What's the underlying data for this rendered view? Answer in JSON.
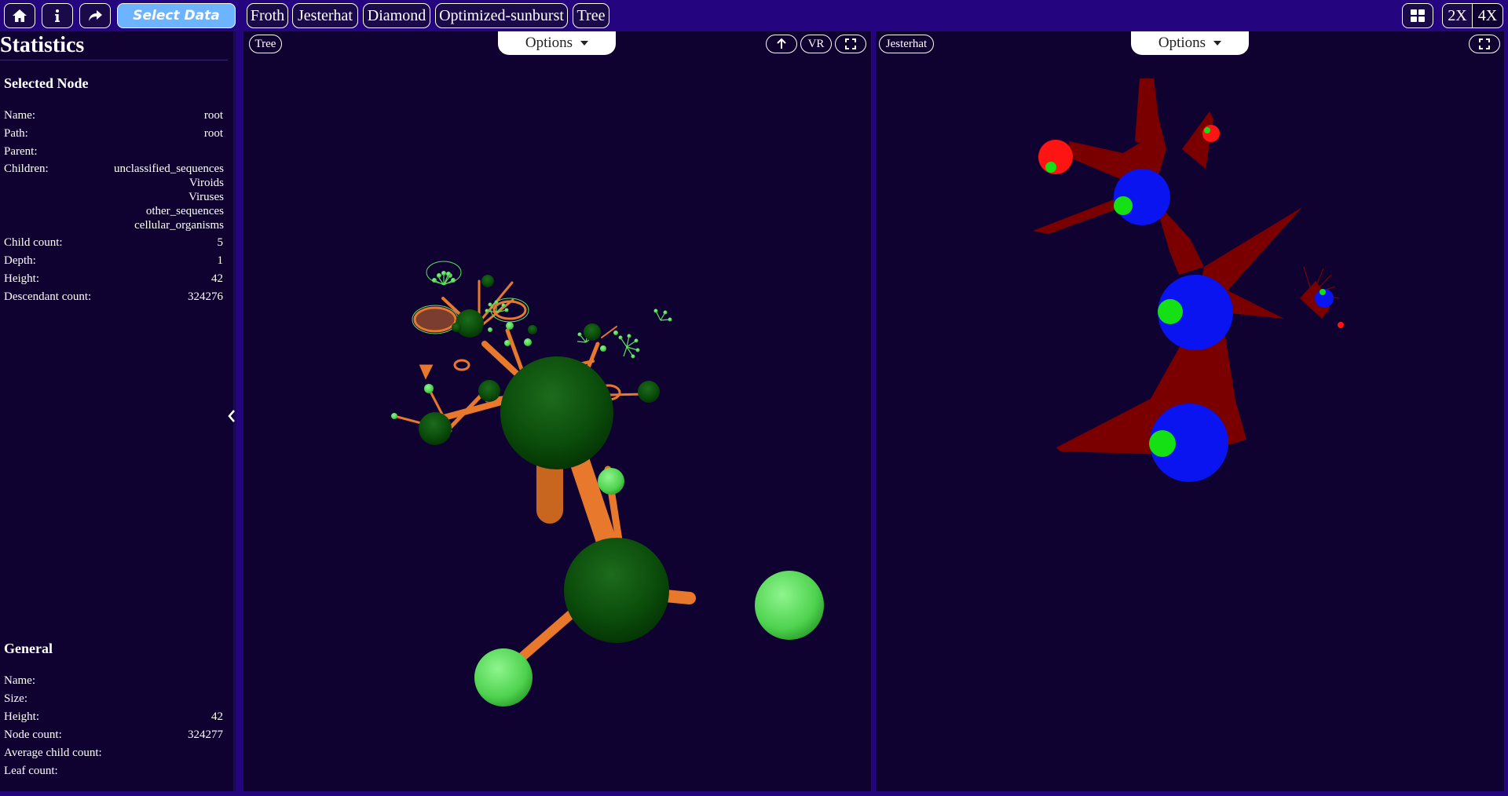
{
  "toolbar": {
    "home_icon": "home-icon",
    "info_icon": "info-icon",
    "share_icon": "share-icon",
    "select_data_label": "Select Data",
    "views": [
      "Froth",
      "Jesterhat",
      "Diamond",
      "Optimized-sunburst",
      "Tree"
    ],
    "grid_icon": "grid-layout-icon",
    "zoom_2x": "2X",
    "zoom_4x": "4X"
  },
  "sidebar": {
    "title": "Statistics",
    "selected_node": {
      "heading": "Selected Node",
      "name_label": "Name:",
      "name_value": "root",
      "path_label": "Path:",
      "path_value": "root",
      "parent_label": "Parent:",
      "parent_value": "",
      "children_label": "Children:",
      "children": [
        "unclassified_sequences",
        "Viroids",
        "Viruses",
        "other_sequences",
        "cellular_organisms"
      ],
      "child_count_label": "Child count:",
      "child_count_value": "5",
      "depth_label": "Depth:",
      "depth_value": "1",
      "height_label": "Height:",
      "height_value": "42",
      "descendant_label": "Descendant count:",
      "descendant_value": "324276"
    },
    "general": {
      "heading": "General",
      "name_label": "Name:",
      "name_value": "",
      "size_label": "Size:",
      "size_value": "",
      "height_label": "Height:",
      "height_value": "42",
      "node_count_label": "Node count:",
      "node_count_value": "324277",
      "avg_child_label": "Average child count:",
      "avg_child_value": "",
      "leaf_count_label": "Leaf count:",
      "leaf_count_value": ""
    },
    "collapse_icon": "chevron-left-icon"
  },
  "left_panel": {
    "view_tag": "Tree",
    "options_label": "Options",
    "up_icon": "arrow-up-icon",
    "vr_label": "VR",
    "fullscreen_icon": "fullscreen-icon"
  },
  "right_panel": {
    "view_tag": "Jesterhat",
    "options_label": "Options",
    "fullscreen_icon": "fullscreen-icon"
  },
  "colors": {
    "background": "#250480",
    "panel": "#0f0231",
    "branch": "#e8782c",
    "node_dark": "#0b5a0b",
    "node_light": "#5ee05e",
    "jester_red": "#7a0000",
    "jester_blue": "#0a14f0",
    "select_data": "#6cb4ff"
  }
}
